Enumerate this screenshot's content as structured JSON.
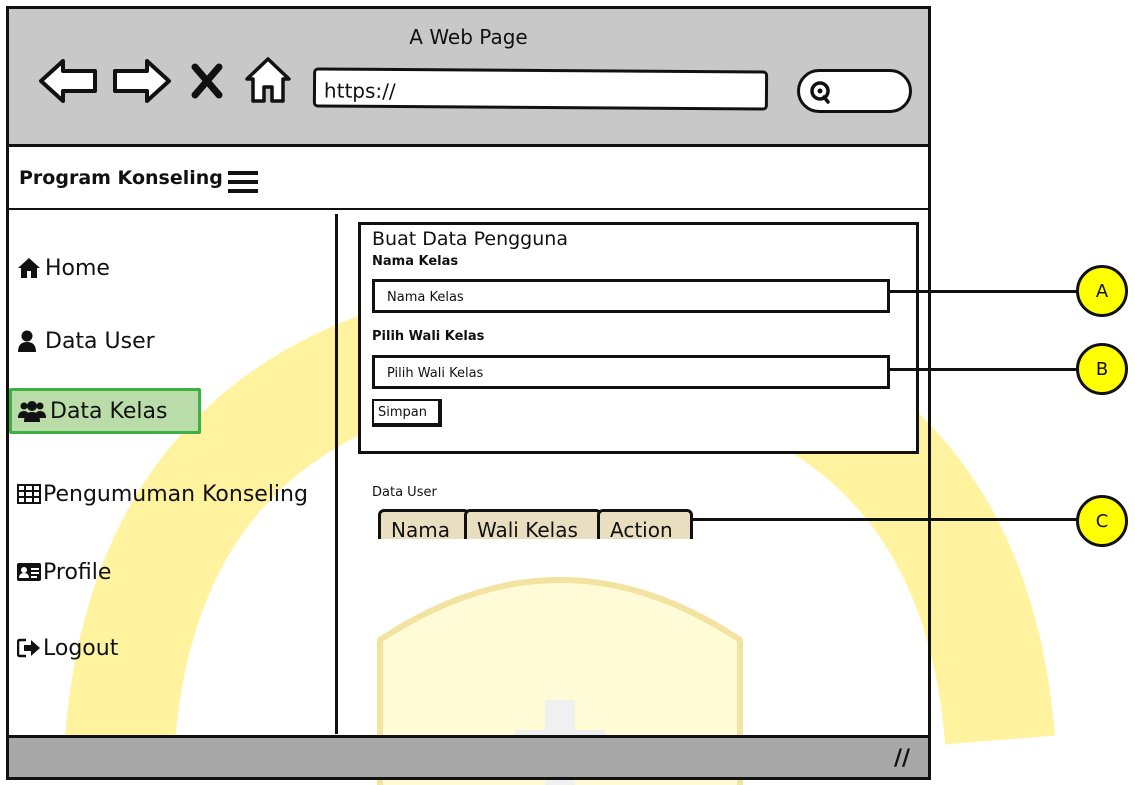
{
  "browser": {
    "title": "A Web Page",
    "url": "https://"
  },
  "app": {
    "title": "Program Konseling"
  },
  "sidebar": {
    "items": [
      {
        "label": "Home",
        "icon": "home-icon"
      },
      {
        "label": "Data User",
        "icon": "user-icon"
      },
      {
        "label": "Data Kelas",
        "icon": "users-icon",
        "active": true
      },
      {
        "label": "Pengumuman Konseling",
        "icon": "table-icon"
      },
      {
        "label": "Profile",
        "icon": "id-card-icon"
      },
      {
        "label": "Logout",
        "icon": "logout-icon"
      }
    ]
  },
  "form": {
    "title": "Buat Data Pengguna",
    "nama_kelas_label": "Nama Kelas",
    "nama_kelas_value": "Nama Kelas",
    "wali_kelas_label": "Pilih Wali Kelas",
    "wali_kelas_value": "Pilih Wali Kelas",
    "save_label": "Simpan"
  },
  "table": {
    "caption": "Data User",
    "columns": [
      "Nama",
      "Wali Kelas",
      "Action"
    ]
  },
  "callouts": [
    "A",
    "B",
    "C"
  ],
  "colors": {
    "browser_bar": "#c8c8c8",
    "active_item_bg": "#b9dca8",
    "active_item_border": "#3cb043",
    "callout": "#ffff00",
    "tab": "#e9dfc0",
    "watermark": "#fff3a0"
  }
}
